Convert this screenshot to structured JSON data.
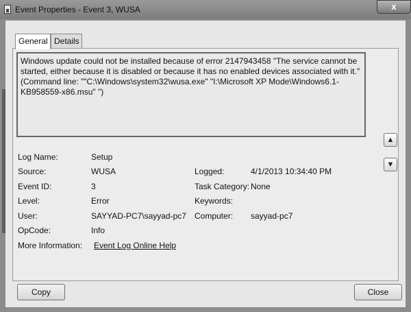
{
  "window": {
    "title": "Event Properties - Event 3, WUSA",
    "close_label": "x"
  },
  "tabs": [
    {
      "label": "General"
    },
    {
      "label": "Details"
    }
  ],
  "message": "Windows update  could not be installed because of error 2147943458 \"The service cannot be started, either because it is disabled or because it has no enabled devices associated with it.\" (Command line: \"\"C:\\Windows\\system32\\wusa.exe\" \"I:\\Microsoft XP Mode\\Windows6.1-KB958559-x86.msu\"        \")",
  "nav": {
    "up_icon": "up-arrow-icon",
    "down_icon": "down-arrow-icon",
    "up_glyph": "▲",
    "down_glyph": "▼"
  },
  "fields": {
    "log_name": {
      "label": "Log Name:",
      "value": "Setup"
    },
    "source": {
      "label": "Source:",
      "value": "WUSA"
    },
    "logged": {
      "label": "Logged:",
      "value": "4/1/2013 10:34:40 PM"
    },
    "event_id": {
      "label": "Event ID:",
      "value": "3"
    },
    "task_category": {
      "label": "Task Category:",
      "value": "None"
    },
    "level": {
      "label": "Level:",
      "value": "Error"
    },
    "keywords": {
      "label": "Keywords:",
      "value": ""
    },
    "user": {
      "label": "User:",
      "value": "SAYYAD-PC7\\sayyad-pc7"
    },
    "computer": {
      "label": "Computer:",
      "value": "sayyad-pc7"
    },
    "opcode": {
      "label": "OpCode:",
      "value": "Info"
    },
    "more_info": {
      "label": "More Information:",
      "value": "Event Log Online Help"
    }
  },
  "buttons": {
    "copy": "Copy",
    "close": "Close"
  }
}
